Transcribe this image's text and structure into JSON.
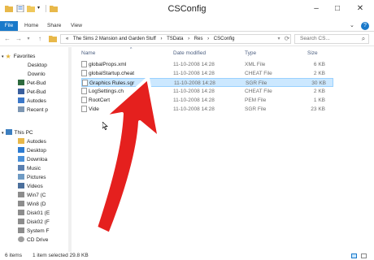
{
  "window": {
    "title": "CSConfig",
    "minimize": "–",
    "maximize": "□",
    "close": "✕"
  },
  "ribbon": {
    "tabs": [
      "File",
      "Home",
      "Share",
      "View"
    ],
    "expand_icon": "chevron-down-icon",
    "help_icon": "help-icon"
  },
  "address": {
    "segments": [
      "«",
      "The Sims 2 Mansion and Garden Stuff",
      "›",
      "TSData",
      "›",
      "Res",
      "›",
      "CSConfig"
    ],
    "search_placeholder": "Search CS..."
  },
  "nav": {
    "favorites_label": "Favorites",
    "favorites": [
      "Desktop",
      "Downlo",
      "Pet-Bud",
      "Pet-Bud",
      "Autodes",
      "Recent p"
    ],
    "thispc_label": "This PC",
    "thispc": [
      "Autodes",
      "Desktop",
      "Downloa",
      "Music",
      "Pictures",
      "Videos",
      "Win7 (C",
      "Win8 (D",
      "Disk01 (E",
      "Disk02 (F",
      "System F",
      "CD Drive"
    ]
  },
  "columns": {
    "name": "Name",
    "date": "Date modified",
    "type": "Type",
    "size": "Size"
  },
  "files": [
    {
      "name": "globalProps.xml",
      "date": "11-10-2008 14:28",
      "type": "XML File",
      "size": "6 KB",
      "selected": false
    },
    {
      "name": "globalStartup.cheat",
      "date": "11-10-2008 14:28",
      "type": "CHEAT File",
      "size": "2 KB",
      "selected": false
    },
    {
      "name": "Graphics Rules.sgr",
      "date": "11-10-2008 14:28",
      "type": "SGR File",
      "size": "30 KB",
      "selected": true
    },
    {
      "name": "LogSettings.ch",
      "date": "11-10-2008 14:28",
      "type": "CHEAT File",
      "size": "2 KB",
      "selected": false
    },
    {
      "name": "RootCert",
      "date": "11-10-2008 14:28",
      "type": "PEM File",
      "size": "1 KB",
      "selected": false
    },
    {
      "name": "Vide",
      "date": "11-10-2008 14:28",
      "type": "SGR File",
      "size": "23 KB",
      "selected": false
    }
  ],
  "status": {
    "count": "6 items",
    "selection": "1 item selected  29.8 KB"
  },
  "colors": {
    "accent": "#1979ca",
    "selection": "#cce8ff",
    "arrow": "#e5201e"
  }
}
